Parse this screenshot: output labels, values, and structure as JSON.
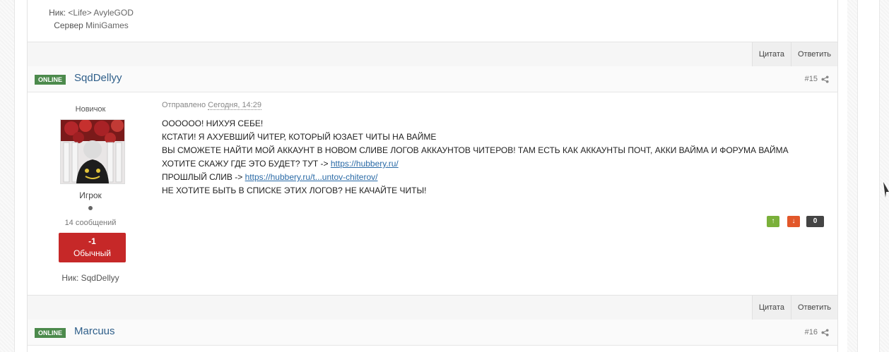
{
  "prev_post": {
    "nick_label": "Ник: ",
    "nick_value": "<Life> AvyleGOD",
    "server_label": "Сервер ",
    "server_value": "MiniGames"
  },
  "actions": {
    "quote": "Цитата",
    "reply": "Ответить"
  },
  "post15": {
    "online": "ONLINE",
    "username": "SqdDellyy",
    "number": "#15",
    "rank": "Новичок",
    "group": "Игрок",
    "messages": "14 сообщений",
    "rep_value": "-1",
    "rep_title": "Обычный",
    "nick": "Ник: SqdDellyy",
    "sent_label": "Отправлено ",
    "sent_date": "Сегодня, 14:29",
    "lines": [
      "ОООООО! НИХУЯ СЕБЕ!",
      "КСТАТИ! Я АХУЕВШИЙ ЧИТЕР, КОТОРЫЙ ЮЗАЕТ ЧИТЫ НА ВАЙМЕ",
      "ВЫ СМОЖЕТЕ НАЙТИ МОЙ АККАУНТ В НОВОМ СЛИВЕ ЛОГОВ АККАУНТОВ ЧИТЕРОВ! ТАМ ЕСТЬ КАК АККАУНТЫ ПОЧТ, АККИ ВАЙМА И ФОРУМА ВАЙМА"
    ],
    "line4_text": "ХОТИТЕ СКАЖУ ГДЕ ЭТО БУДЕТ? ТУТ -> ",
    "line4_link": "https://hubbery.ru/",
    "line5_text": "ПРОШЛЫЙ СЛИВ -> ",
    "line5_link": "https://hubbery.ru/t...untov-chiterov/",
    "line6": "НЕ ХОТИТЕ БЫТЬ В СПИСКЕ ЭТИХ ЛОГОВ? НЕ КАЧАЙТЕ ЧИТЫ!",
    "vote_up": "↑",
    "vote_down": "↓",
    "score": "0"
  },
  "post16": {
    "online": "ONLINE",
    "username": "Marcuus",
    "number": "#16"
  },
  "colors": {
    "online_badge": "#4c8a4c",
    "username": "#2f5f8a",
    "rep_negative": "#c62828",
    "link": "#2a6aa6"
  },
  "icons": [
    "share-icon",
    "arrow-up-icon",
    "arrow-down-icon"
  ]
}
